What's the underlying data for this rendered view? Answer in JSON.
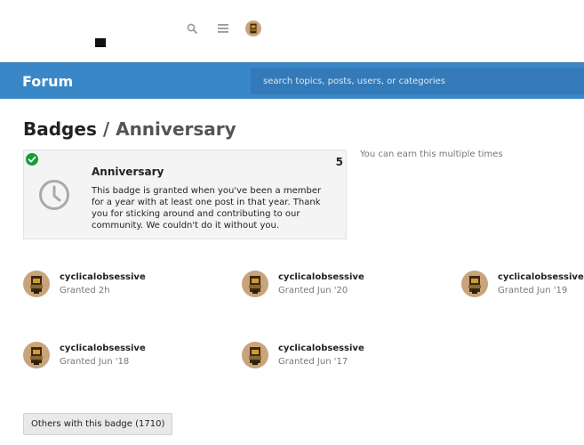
{
  "header": {
    "forum_title": "Forum",
    "search_placeholder": "search topics, posts, users, or categories"
  },
  "page": {
    "title_main": "Badges",
    "title_sep": "/",
    "title_crumb": "Anniversary"
  },
  "badge": {
    "name": "Anniversary",
    "description": "This badge is granted when you've been a member for a year with at least one post in that year. Thank you for sticking around and contributing to our community. We couldn't do it without you.",
    "grant_count": "5",
    "multiple_note": "You can earn this multiple times",
    "icons": [
      "check-circle-icon",
      "clock-icon"
    ]
  },
  "grants": [
    {
      "username": "cyclicalobsessive",
      "granted": "Granted 2h"
    },
    {
      "username": "cyclicalobsessive",
      "granted": "Granted Jun '20"
    },
    {
      "username": "cyclicalobsessive",
      "granted": "Granted Jun '19"
    },
    {
      "username": "cyclicalobsessive",
      "granted": "Granted Jun '18"
    },
    {
      "username": "cyclicalobsessive",
      "granted": "Granted Jun '17"
    }
  ],
  "others_button": "Others with this badge (1710)",
  "colors": {
    "accent": "#3a87c8",
    "success": "#1a9a3c"
  }
}
